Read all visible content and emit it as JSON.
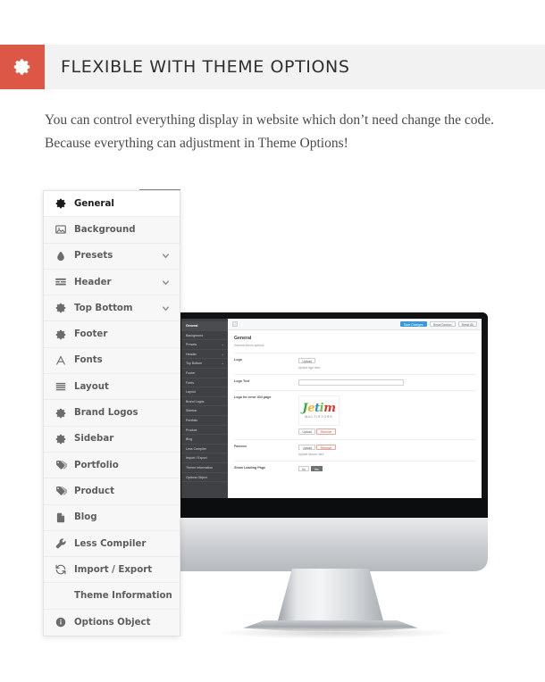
{
  "header": {
    "badge_icon": "gear-icon",
    "title": "FLEXIBLE WITH THEME OPTIONS",
    "badge_color": "#dd5746",
    "band_color": "#f2f2f2"
  },
  "intro": {
    "line1": "You can control everything display in website which don’t need change the code.",
    "line2": "Because everything can adjustment in Theme Options!"
  },
  "menu": {
    "items": [
      {
        "label": "General",
        "icon": "gear-icon",
        "chevron": false,
        "active": true
      },
      {
        "label": "Background",
        "icon": "image-icon",
        "chevron": false,
        "active": false
      },
      {
        "label": "Presets",
        "icon": "droplet-icon",
        "chevron": true,
        "active": false
      },
      {
        "label": "Header",
        "icon": "header-icon",
        "chevron": true,
        "active": false
      },
      {
        "label": "Top Bottom",
        "icon": "gear-icon",
        "chevron": true,
        "active": false
      },
      {
        "label": "Footer",
        "icon": "gear-icon",
        "chevron": false,
        "active": false
      },
      {
        "label": "Fonts",
        "icon": "font-a-icon",
        "chevron": false,
        "active": false
      },
      {
        "label": "Layout",
        "icon": "layout-icon",
        "chevron": false,
        "active": false
      },
      {
        "label": "Brand Logos",
        "icon": "gear-icon",
        "chevron": false,
        "active": false
      },
      {
        "label": "Sidebar",
        "icon": "gear-icon",
        "chevron": false,
        "active": false
      },
      {
        "label": "Portfolio",
        "icon": "tags-icon",
        "chevron": false,
        "active": false
      },
      {
        "label": "Product",
        "icon": "tags-icon",
        "chevron": false,
        "active": false
      },
      {
        "label": "Blog",
        "icon": "page-icon",
        "chevron": false,
        "active": false
      },
      {
        "label": "Less Compiler",
        "icon": "wrench-icon",
        "chevron": false,
        "active": false
      },
      {
        "label": "Import / Export",
        "icon": "refresh-icon",
        "chevron": false,
        "active": false
      },
      {
        "label": "Theme Information",
        "icon": "none",
        "chevron": false,
        "active": false
      },
      {
        "label": "Options Object",
        "icon": "info-icon",
        "chevron": false,
        "active": false
      }
    ]
  },
  "screen": {
    "toolbar": {
      "save_label": "Save Changes",
      "reset_section_label": "Reset Section",
      "reset_all_label": "Reset All",
      "primary_color": "#3a9ad9"
    },
    "panel": {
      "title": "General",
      "subtitle": "General theme options"
    },
    "fields": [
      {
        "label": "Logo",
        "upload_label": "Upload",
        "hint": "Upload logo here."
      },
      {
        "label": "Logo Text",
        "input_value": ""
      },
      {
        "label": "Logo for error 404 page",
        "logo_script": "Jetim",
        "logo_sub": "MULTISTORE",
        "upload_label": "Upload",
        "remove_label": "Remove"
      },
      {
        "label": "Favicon",
        "upload_label": "Upload",
        "remove_label": "Remove",
        "hint": "Upload favicon here."
      },
      {
        "label": "Show Loading Page",
        "toggle_off": "No",
        "toggle_on": "Yes"
      }
    ],
    "sidebar_items": [
      "General",
      "Background",
      "Presets",
      "Header",
      "Top Bottom",
      "Footer",
      "Fonts",
      "Layout",
      "Brand Logos",
      "Sidebar",
      "Portfolio",
      "Product",
      "Blog",
      "Less Compiler",
      "Import / Export",
      "Theme Information",
      "Options Object"
    ]
  }
}
